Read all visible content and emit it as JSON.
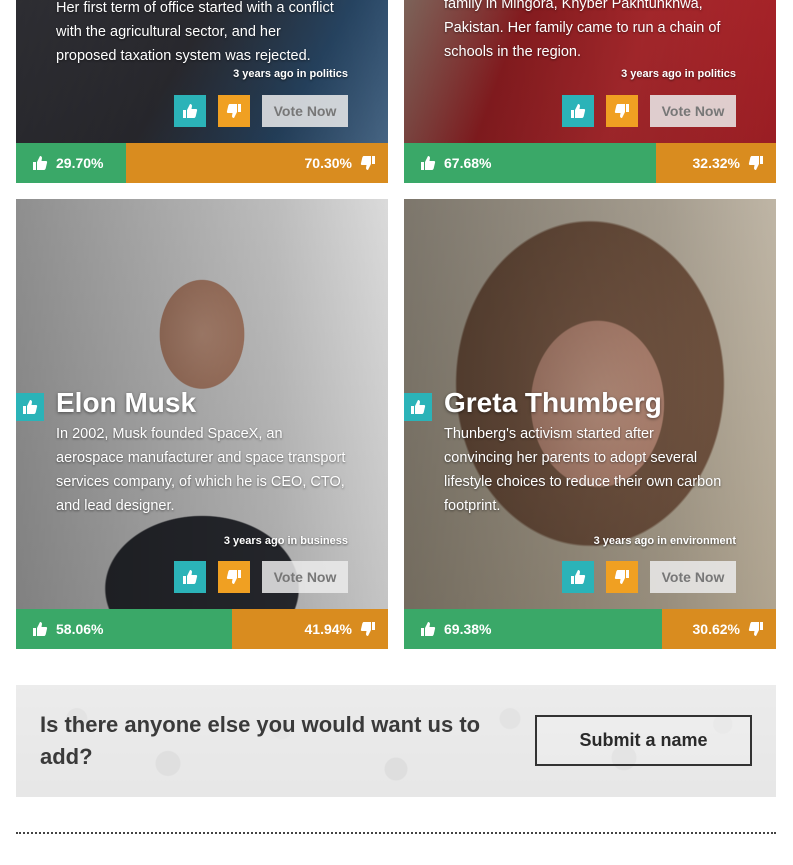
{
  "cards": [
    {
      "name": "",
      "description": "Her first term of office started with a conflict with the agricultural sector, and her proposed taxation system was rejected.",
      "meta": "3 years ago in politics",
      "vote_label": "Vote Now",
      "up_pct": "29.70%",
      "down_pct": "70.30%",
      "up_share": 0.297
    },
    {
      "name": "",
      "description": "family in Mingora, Khyber Pakhtunkhwa, Pakistan. Her family came to run a chain of schools in the region.",
      "meta": "3 years ago in politics",
      "vote_label": "Vote Now",
      "up_pct": "67.68%",
      "down_pct": "32.32%",
      "up_share": 0.6768
    },
    {
      "name": "Elon Musk",
      "description": "In 2002, Musk founded SpaceX, an aerospace manufacturer and space transport services company, of which he is CEO, CTO, and lead designer.",
      "meta": "3 years ago in business",
      "vote_label": "Vote Now",
      "up_pct": "58.06%",
      "down_pct": "41.94%",
      "up_share": 0.5806
    },
    {
      "name": "Greta Thumberg",
      "description": "Thunberg's activism started after convincing her parents to adopt several lifestyle choices to reduce their own carbon footprint.",
      "meta": "3 years ago in environment",
      "vote_label": "Vote Now",
      "up_pct": "69.38%",
      "down_pct": "30.62%",
      "up_share": 0.6938
    }
  ],
  "banner": {
    "question": "Is there anyone else you would want us to add?",
    "submit_label": "Submit a name"
  },
  "colors": {
    "teal": "#2bb3b8",
    "orange": "#f0a022",
    "green_bar": "#3aa868",
    "orange_bar": "#d98c1f"
  },
  "icons": [
    "thumbs-up-icon",
    "thumbs-down-icon"
  ]
}
